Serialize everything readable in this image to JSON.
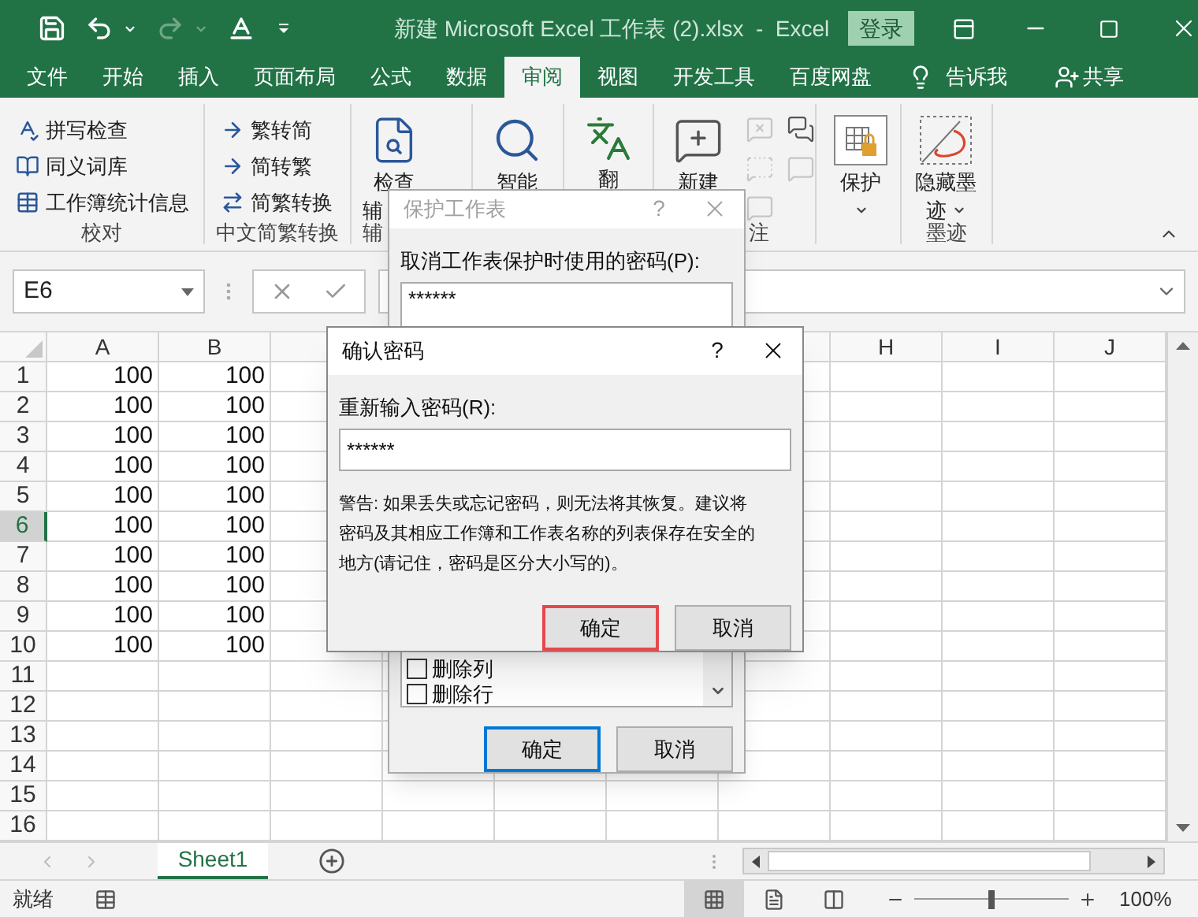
{
  "window": {
    "title": "新建 Microsoft Excel 工作表 (2).xlsx  -  Excel",
    "sign_in": "登录"
  },
  "quick_access": [
    {
      "kind": "save",
      "disabled": false
    },
    {
      "kind": "undo",
      "disabled": false
    },
    {
      "kind": "redo",
      "disabled": true
    },
    {
      "kind": "font_color",
      "disabled": false
    },
    {
      "kind": "customize",
      "disabled": false
    }
  ],
  "tabs": [
    {
      "label": "文件",
      "selected": false
    },
    {
      "label": "开始",
      "selected": false
    },
    {
      "label": "插入",
      "selected": false
    },
    {
      "label": "页面布局",
      "selected": false
    },
    {
      "label": "公式",
      "selected": false
    },
    {
      "label": "数据",
      "selected": false
    },
    {
      "label": "审阅",
      "selected": true
    },
    {
      "label": "视图",
      "selected": false
    },
    {
      "label": "开发工具",
      "selected": false
    },
    {
      "label": "百度网盘",
      "selected": false
    }
  ],
  "tell_me": "告诉我",
  "share": "共享",
  "ribbon": {
    "groups": [
      {
        "kind": "small_list",
        "label": "校对",
        "items": [
          {
            "kind": "spell",
            "label": "拼写检查"
          },
          {
            "kind": "thesaurus",
            "label": "同义词库"
          },
          {
            "kind": "stats",
            "label": "工作簿统计信息"
          }
        ]
      },
      {
        "kind": "small_list",
        "label": "中文简繁转换",
        "items": [
          {
            "kind": "to_simplified",
            "label": "繁转简"
          },
          {
            "kind": "to_traditional",
            "label": "简转繁"
          },
          {
            "kind": "convert",
            "label": "简繁转换"
          }
        ]
      },
      {
        "kind": "large",
        "label": "辅",
        "buttons": [
          {
            "kind": "inspect",
            "lines": [
              "检查",
              "辅"
            ]
          }
        ]
      },
      {
        "kind": "large",
        "buttons": [
          {
            "kind": "insights",
            "lines": [
              "智能"
            ]
          }
        ]
      },
      {
        "kind": "large",
        "buttons": [
          {
            "kind": "translate",
            "lines": [
              "翻"
            ]
          }
        ]
      },
      {
        "kind": "comments",
        "label": "注",
        "buttons": [
          {
            "kind": "new_comment",
            "lines": [
              "新建"
            ]
          }
        ],
        "small_buttons": [
          {
            "kind": "delete",
            "disabled": true
          },
          {
            "kind": "show_hide",
            "disabled": true
          },
          {
            "kind": "previous",
            "disabled": true
          },
          {
            "kind": "show_all",
            "disabled": false
          },
          {
            "kind": "next",
            "disabled": true
          }
        ]
      },
      {
        "kind": "large",
        "buttons": [
          {
            "kind": "protect",
            "lines": [
              "保护"
            ],
            "dropdown": true
          }
        ]
      },
      {
        "kind": "large",
        "label": "墨迹",
        "buttons": [
          {
            "kind": "ink",
            "lines": [
              "隐藏墨",
              "迹"
            ],
            "dropdown": true
          }
        ]
      }
    ]
  },
  "name_box": "E6",
  "sheet": {
    "columns": [
      {
        "label": "A"
      },
      {
        "label": "B"
      },
      {},
      {},
      {},
      {},
      {},
      {
        "label": "H"
      },
      {
        "label": "I"
      },
      {
        "label": "J"
      }
    ],
    "rows": [
      {
        "label": "1",
        "selected": false,
        "cells": [
          "100",
          "100"
        ]
      },
      {
        "label": "2",
        "selected": false,
        "cells": [
          "100",
          "100"
        ]
      },
      {
        "label": "3",
        "selected": false,
        "cells": [
          "100",
          "100"
        ]
      },
      {
        "label": "4",
        "selected": false,
        "cells": [
          "100",
          "100"
        ]
      },
      {
        "label": "5",
        "selected": false,
        "cells": [
          "100",
          "100"
        ]
      },
      {
        "label": "6",
        "selected": true,
        "cells": [
          "100",
          "100"
        ]
      },
      {
        "label": "7",
        "selected": false,
        "cells": [
          "100",
          "100"
        ]
      },
      {
        "label": "8",
        "selected": false,
        "cells": [
          "100",
          "100"
        ]
      },
      {
        "label": "9",
        "selected": false,
        "cells": [
          "100",
          "100"
        ]
      },
      {
        "label": "10",
        "selected": false,
        "cells": [
          "100",
          "100"
        ]
      },
      {
        "label": "11",
        "selected": false
      },
      {
        "label": "12",
        "selected": false
      },
      {
        "label": "13",
        "selected": false
      },
      {
        "label": "14",
        "selected": false
      },
      {
        "label": "15",
        "selected": false
      },
      {
        "label": "16",
        "selected": false
      }
    ]
  },
  "sheet_tabs": [
    {
      "label": "Sheet1",
      "selected": true
    }
  ],
  "status": "就绪",
  "views": [
    {
      "kind": "normal",
      "selected": true
    },
    {
      "kind": "page_layout",
      "selected": false
    },
    {
      "kind": "page_break",
      "selected": false
    }
  ],
  "zoom": {
    "level": 0.5,
    "reading": "100%"
  },
  "protect_dialog": {
    "title": "保护工作表",
    "active": false,
    "help": "?",
    "password_label": "取消工作表保护时使用的密码(P):",
    "password": "******",
    "permissions": [
      {
        "label": "删除列",
        "checked": false
      },
      {
        "label": "删除行",
        "checked": false
      }
    ],
    "buttons": [
      {
        "label": "确定",
        "default": true
      },
      {
        "label": "取消",
        "default": false
      }
    ]
  },
  "confirm_dialog": {
    "title": "确认密码",
    "active": true,
    "help": "?",
    "label": "重新输入密码(R):",
    "password": "******",
    "warning_lines": [
      "警告: 如果丢失或忘记密码，则无法将其恢复。建议将",
      "密码及其相应工作簿和工作表名称的列表保存在安全的",
      "地方(请记住，密码是区分大小写的)。"
    ],
    "buttons": [
      {
        "label": "确定",
        "highlighted": true
      },
      {
        "label": "取消",
        "highlighted": false
      }
    ]
  }
}
